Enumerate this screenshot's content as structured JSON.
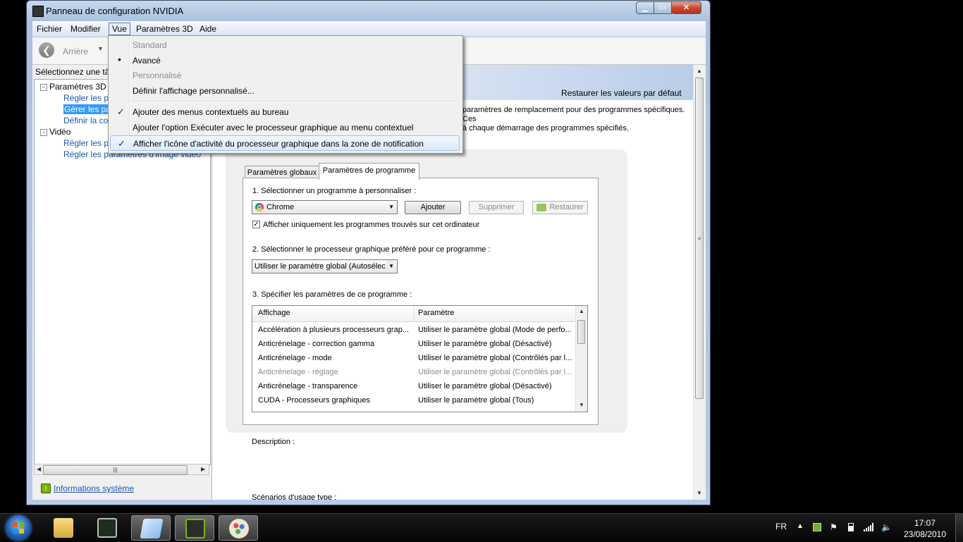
{
  "window": {
    "title": "Panneau de configuration NVIDIA",
    "minimize_glyph": "▁",
    "maximize_glyph": "▭",
    "close_glyph": "✕"
  },
  "menubar": {
    "items": [
      "Fichier",
      "Modifier",
      "Vue",
      "Paramètres 3D",
      "Aide"
    ]
  },
  "vue_menu": {
    "items": [
      {
        "label": "Standard",
        "enabled": false,
        "mark": ""
      },
      {
        "label": "Avancé",
        "enabled": true,
        "mark": "bullet"
      },
      {
        "label": "Personnalisé",
        "enabled": false,
        "mark": ""
      },
      {
        "label": "Définir l'affichage personnalisé...",
        "enabled": true,
        "mark": ""
      },
      {
        "label": "Ajouter des menus contextuels au bureau",
        "enabled": true,
        "mark": "check"
      },
      {
        "label": "Ajouter l'option Exécuter avec le processeur graphique au menu contextuel",
        "enabled": true,
        "mark": ""
      },
      {
        "label": "Afficher l'icône d'activité du processeur graphique dans la zone de notification",
        "enabled": true,
        "mark": "check",
        "highlighted": true
      }
    ]
  },
  "toolbar": {
    "back_label": "Arrière"
  },
  "left_pane": {
    "caption": "Sélectionnez une tâch",
    "tree": {
      "group1": "Paramètres 3D",
      "g1_items": [
        "Régler les pa",
        "Gérer les par",
        "Définir la con"
      ],
      "group2": "Vidéo",
      "g2_items": [
        "Régler les pa",
        "Régler les paramètres d'image vidéo"
      ]
    },
    "system_info_link": "Informations système"
  },
  "right_pane": {
    "restore_defaults": "Restaurer les valeurs par défaut",
    "desc_line1": "paramètres de remplacement pour des programmes spécifiques. Ces",
    "desc_line2": "à chaque démarrage des programmes spécifiés.",
    "tabs": [
      "Paramètres globaux",
      "Paramètres de programme"
    ],
    "step1": "1. Sélectionner un programme à personnaliser :",
    "program_selected": "Chrome",
    "btn_add": "Ajouter",
    "btn_remove": "Supprimer",
    "btn_restore": "Restaurer",
    "checkbox_label": "Afficher uniquement les programmes trouvés sur cet ordinateur",
    "checkbox_checked": true,
    "step2": "2. Sélectionner le processeur graphique préféré pour ce programme :",
    "gpu_selected": "Utiliser le paramètre global (Autosélec",
    "step3": "3. Spécifier les paramètres de ce programme :",
    "grid_headers": [
      "Affichage",
      "Paramètre"
    ],
    "grid_rows": [
      {
        "feature": "Accélération à plusieurs processeurs grap...",
        "setting": "Utiliser le paramètre global (Mode de perfo...",
        "dim": false
      },
      {
        "feature": "Anticrénelage - correction gamma",
        "setting": "Utiliser le paramètre global (Désactivé)",
        "dim": false
      },
      {
        "feature": "Anticrénelage - mode",
        "setting": "Utiliser le paramètre global (Contrôlés par l...",
        "dim": false
      },
      {
        "feature": "Anticrénelage - réglage",
        "setting": "Utiliser le paramètre global (Contrôlés par l...",
        "dim": true
      },
      {
        "feature": "Anticrénelage - transparence",
        "setting": "Utiliser le paramètre global (Désactivé)",
        "dim": false
      },
      {
        "feature": "CUDA - Processeurs graphiques",
        "setting": "Utiliser le paramètre global (Tous)",
        "dim": false
      }
    ],
    "description_label": "Description :",
    "usage_label": "Scénarios d'usage type :"
  },
  "taskbar": {
    "apps": [
      "windows-explorer",
      "task-manager",
      "notepad",
      "nvidia-control-panel",
      "paint"
    ],
    "language": "FR",
    "time": "17:07",
    "date": "23/08/2010"
  },
  "colors": {
    "link": "#1a56b0",
    "selection": "#3399ff",
    "menu_highlight_border": "#9fc2eb"
  }
}
